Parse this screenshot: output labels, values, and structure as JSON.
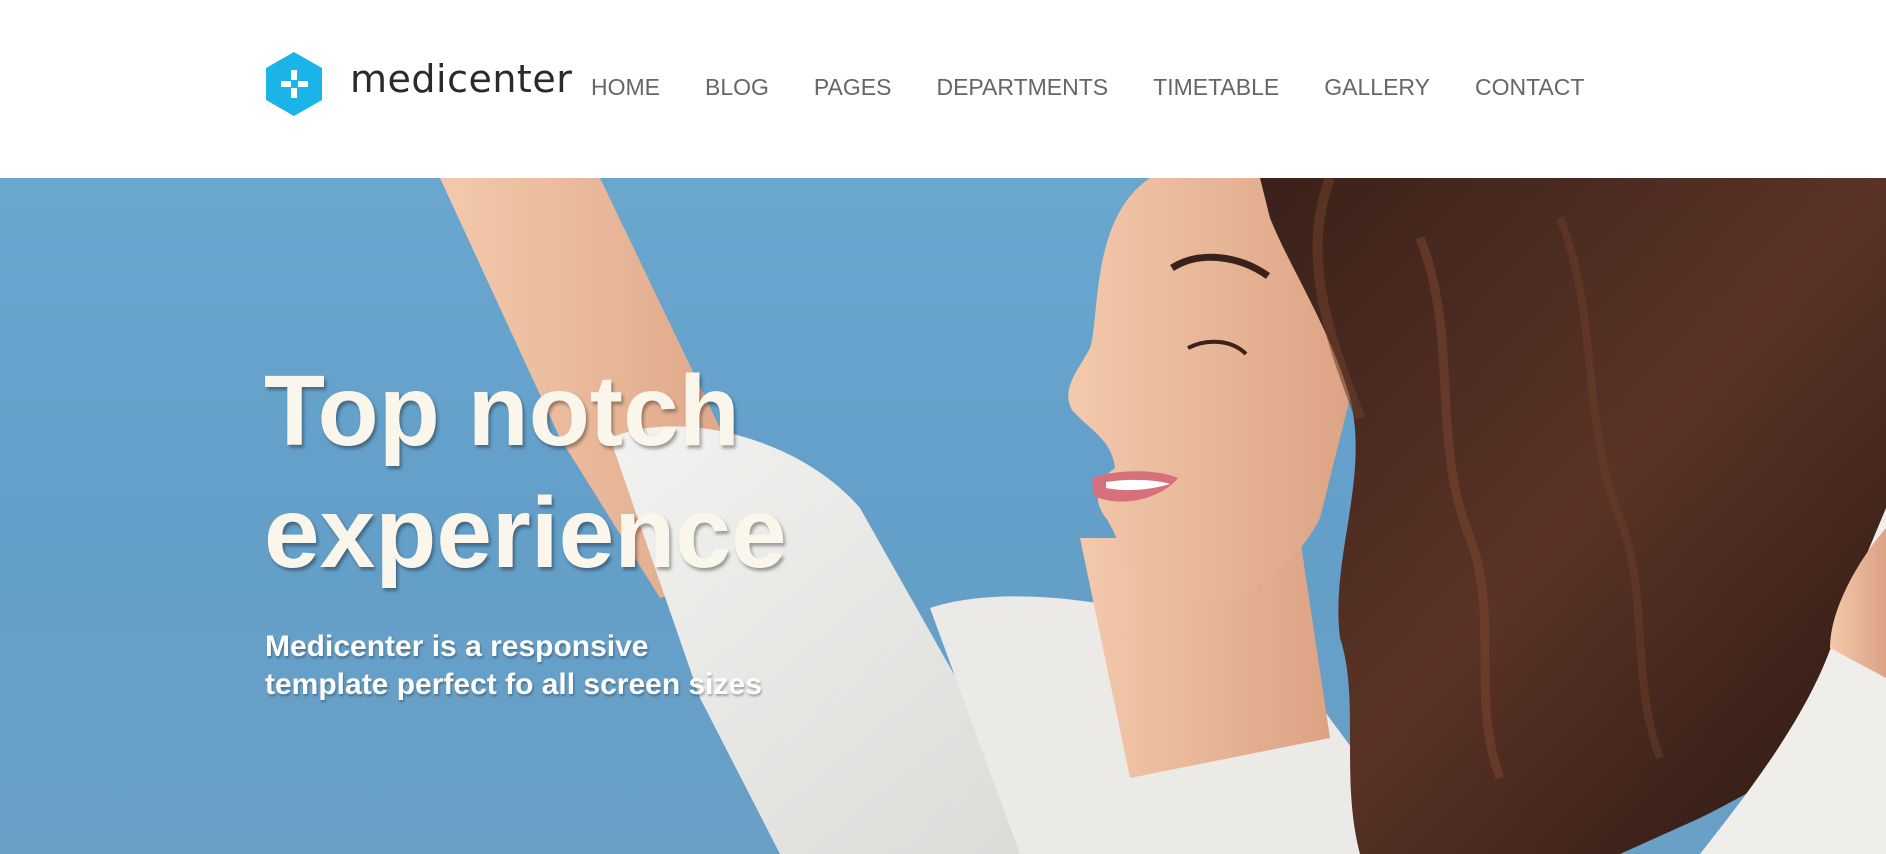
{
  "brand": {
    "name": "medicenter",
    "accent_color": "#1ab4e8",
    "logo_icon": "plus-hexagon-icon"
  },
  "nav": {
    "items": [
      {
        "label": "HOME"
      },
      {
        "label": "BLOG"
      },
      {
        "label": "PAGES"
      },
      {
        "label": "DEPARTMENTS"
      },
      {
        "label": "TIMETABLE"
      },
      {
        "label": "GALLERY"
      },
      {
        "label": "CONTACT"
      }
    ]
  },
  "hero": {
    "title": "Top notch\nexperience",
    "subtitle": "Medicenter is a responsive\ntemplate perfect fo all screen sizes",
    "image": "smiling-woman-sky-photo"
  }
}
